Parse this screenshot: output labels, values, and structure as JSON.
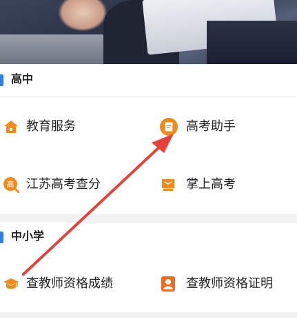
{
  "sections": [
    {
      "title": "高中",
      "items": [
        {
          "label": "教育服务",
          "icon": "house-icon"
        },
        {
          "label": "高考助手",
          "icon": "document-icon"
        },
        {
          "label": "江苏高考查分",
          "icon": "search-score-icon"
        },
        {
          "label": "掌上高考",
          "icon": "book-icon"
        }
      ]
    },
    {
      "title": "中小学",
      "items": [
        {
          "label": "查教师资格成绩",
          "icon": "graduation-cap-icon"
        },
        {
          "label": "查教师资格证明",
          "icon": "person-card-icon"
        }
      ]
    }
  ],
  "icon_glyphs": {
    "search-score": "高"
  },
  "colors": {
    "accent_blue": "#2f80ed",
    "icon_orange": "#f28a1a",
    "annotation_arrow": "#e8413a"
  }
}
